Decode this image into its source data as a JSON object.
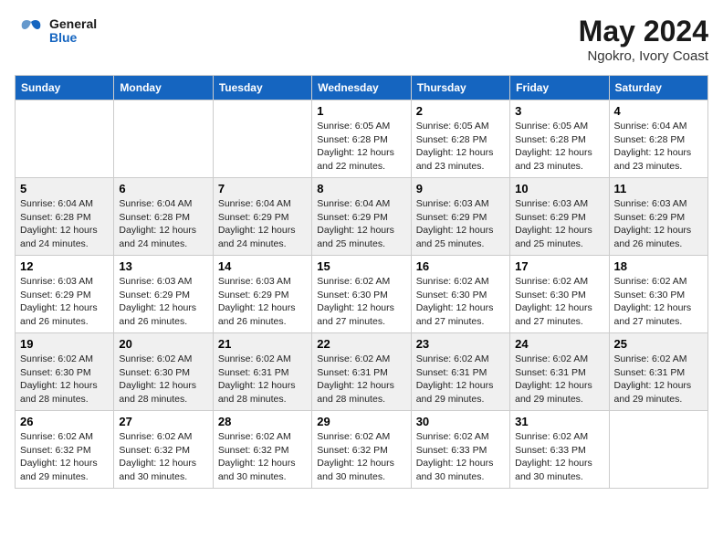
{
  "logo": {
    "line1": "General",
    "line2": "Blue"
  },
  "title": "May 2024",
  "location": "Ngokro, Ivory Coast",
  "weekdays": [
    "Sunday",
    "Monday",
    "Tuesday",
    "Wednesday",
    "Thursday",
    "Friday",
    "Saturday"
  ],
  "weeks": [
    [
      {
        "day": "",
        "info": ""
      },
      {
        "day": "",
        "info": ""
      },
      {
        "day": "",
        "info": ""
      },
      {
        "day": "1",
        "info": "Sunrise: 6:05 AM\nSunset: 6:28 PM\nDaylight: 12 hours and 22 minutes."
      },
      {
        "day": "2",
        "info": "Sunrise: 6:05 AM\nSunset: 6:28 PM\nDaylight: 12 hours and 23 minutes."
      },
      {
        "day": "3",
        "info": "Sunrise: 6:05 AM\nSunset: 6:28 PM\nDaylight: 12 hours and 23 minutes."
      },
      {
        "day": "4",
        "info": "Sunrise: 6:04 AM\nSunset: 6:28 PM\nDaylight: 12 hours and 23 minutes."
      }
    ],
    [
      {
        "day": "5",
        "info": "Sunrise: 6:04 AM\nSunset: 6:28 PM\nDaylight: 12 hours and 24 minutes."
      },
      {
        "day": "6",
        "info": "Sunrise: 6:04 AM\nSunset: 6:28 PM\nDaylight: 12 hours and 24 minutes."
      },
      {
        "day": "7",
        "info": "Sunrise: 6:04 AM\nSunset: 6:29 PM\nDaylight: 12 hours and 24 minutes."
      },
      {
        "day": "8",
        "info": "Sunrise: 6:04 AM\nSunset: 6:29 PM\nDaylight: 12 hours and 25 minutes."
      },
      {
        "day": "9",
        "info": "Sunrise: 6:03 AM\nSunset: 6:29 PM\nDaylight: 12 hours and 25 minutes."
      },
      {
        "day": "10",
        "info": "Sunrise: 6:03 AM\nSunset: 6:29 PM\nDaylight: 12 hours and 25 minutes."
      },
      {
        "day": "11",
        "info": "Sunrise: 6:03 AM\nSunset: 6:29 PM\nDaylight: 12 hours and 26 minutes."
      }
    ],
    [
      {
        "day": "12",
        "info": "Sunrise: 6:03 AM\nSunset: 6:29 PM\nDaylight: 12 hours and 26 minutes."
      },
      {
        "day": "13",
        "info": "Sunrise: 6:03 AM\nSunset: 6:29 PM\nDaylight: 12 hours and 26 minutes."
      },
      {
        "day": "14",
        "info": "Sunrise: 6:03 AM\nSunset: 6:29 PM\nDaylight: 12 hours and 26 minutes."
      },
      {
        "day": "15",
        "info": "Sunrise: 6:02 AM\nSunset: 6:30 PM\nDaylight: 12 hours and 27 minutes."
      },
      {
        "day": "16",
        "info": "Sunrise: 6:02 AM\nSunset: 6:30 PM\nDaylight: 12 hours and 27 minutes."
      },
      {
        "day": "17",
        "info": "Sunrise: 6:02 AM\nSunset: 6:30 PM\nDaylight: 12 hours and 27 minutes."
      },
      {
        "day": "18",
        "info": "Sunrise: 6:02 AM\nSunset: 6:30 PM\nDaylight: 12 hours and 27 minutes."
      }
    ],
    [
      {
        "day": "19",
        "info": "Sunrise: 6:02 AM\nSunset: 6:30 PM\nDaylight: 12 hours and 28 minutes."
      },
      {
        "day": "20",
        "info": "Sunrise: 6:02 AM\nSunset: 6:30 PM\nDaylight: 12 hours and 28 minutes."
      },
      {
        "day": "21",
        "info": "Sunrise: 6:02 AM\nSunset: 6:31 PM\nDaylight: 12 hours and 28 minutes."
      },
      {
        "day": "22",
        "info": "Sunrise: 6:02 AM\nSunset: 6:31 PM\nDaylight: 12 hours and 28 minutes."
      },
      {
        "day": "23",
        "info": "Sunrise: 6:02 AM\nSunset: 6:31 PM\nDaylight: 12 hours and 29 minutes."
      },
      {
        "day": "24",
        "info": "Sunrise: 6:02 AM\nSunset: 6:31 PM\nDaylight: 12 hours and 29 minutes."
      },
      {
        "day": "25",
        "info": "Sunrise: 6:02 AM\nSunset: 6:31 PM\nDaylight: 12 hours and 29 minutes."
      }
    ],
    [
      {
        "day": "26",
        "info": "Sunrise: 6:02 AM\nSunset: 6:32 PM\nDaylight: 12 hours and 29 minutes."
      },
      {
        "day": "27",
        "info": "Sunrise: 6:02 AM\nSunset: 6:32 PM\nDaylight: 12 hours and 30 minutes."
      },
      {
        "day": "28",
        "info": "Sunrise: 6:02 AM\nSunset: 6:32 PM\nDaylight: 12 hours and 30 minutes."
      },
      {
        "day": "29",
        "info": "Sunrise: 6:02 AM\nSunset: 6:32 PM\nDaylight: 12 hours and 30 minutes."
      },
      {
        "day": "30",
        "info": "Sunrise: 6:02 AM\nSunset: 6:33 PM\nDaylight: 12 hours and 30 minutes."
      },
      {
        "day": "31",
        "info": "Sunrise: 6:02 AM\nSunset: 6:33 PM\nDaylight: 12 hours and 30 minutes."
      },
      {
        "day": "",
        "info": ""
      }
    ]
  ]
}
